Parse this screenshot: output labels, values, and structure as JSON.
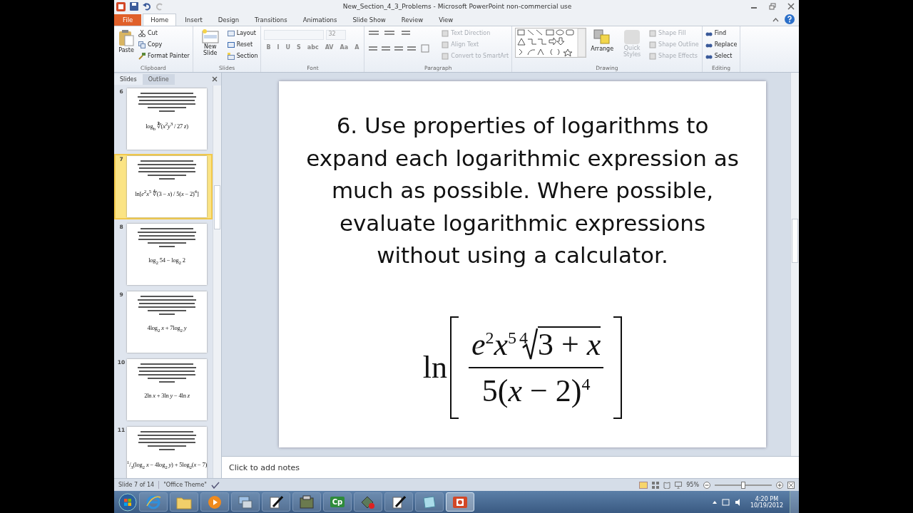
{
  "window": {
    "title": "New_Section_4_3_Problems - Microsoft PowerPoint non-commercial use"
  },
  "tabs": [
    {
      "label": "File",
      "kind": "file",
      "selected": false
    },
    {
      "label": "Home",
      "kind": "tab",
      "selected": true
    },
    {
      "label": "Insert",
      "kind": "tab",
      "selected": false
    },
    {
      "label": "Design",
      "kind": "tab",
      "selected": false
    },
    {
      "label": "Transitions",
      "kind": "tab",
      "selected": false
    },
    {
      "label": "Animations",
      "kind": "tab",
      "selected": false
    },
    {
      "label": "Slide Show",
      "kind": "tab",
      "selected": false
    },
    {
      "label": "Review",
      "kind": "tab",
      "selected": false
    },
    {
      "label": "View",
      "kind": "tab",
      "selected": false
    }
  ],
  "ribbon": {
    "clipboard": {
      "label": "Clipboard",
      "paste": "Paste",
      "cut": "Cut",
      "copy": "Copy",
      "format_painter": "Format Painter"
    },
    "slides": {
      "label": "Slides",
      "new_slide": "New Slide",
      "layout": "Layout",
      "reset": "Reset",
      "section": "Section"
    },
    "font": {
      "label": "Font",
      "font_size": "32",
      "format_buttons": [
        {
          "label": "B"
        },
        {
          "label": "I"
        },
        {
          "label": "U"
        },
        {
          "label": "S"
        },
        {
          "label": "abc"
        },
        {
          "label": "AV"
        },
        {
          "label": "Aa"
        },
        {
          "label": "A"
        }
      ]
    },
    "paragraph": {
      "label": "Paragraph",
      "commands": [
        {
          "label": "Text Direction",
          "disabled": true
        },
        {
          "label": "Align Text",
          "disabled": true
        },
        {
          "label": "Convert to SmartArt",
          "disabled": true
        }
      ]
    },
    "drawing": {
      "label": "Drawing",
      "arrange": "Arrange",
      "quick_styles": {
        "label": "Quick Styles",
        "disabled": true
      },
      "commands": [
        {
          "label": "Shape Fill",
          "disabled": true
        },
        {
          "label": "Shape Outline",
          "disabled": true
        },
        {
          "label": "Shape Effects",
          "disabled": true
        }
      ]
    },
    "editing": {
      "label": "Editing",
      "commands": [
        {
          "label": "Find"
        },
        {
          "label": "Replace"
        },
        {
          "label": "Select"
        }
      ]
    }
  },
  "pane": {
    "tabs": [
      {
        "label": "Slides",
        "selected": true
      },
      {
        "label": "Outline",
        "selected": false
      }
    ],
    "thumbnails": [
      {
        "number": "6",
        "selected": false,
        "formula": "log$_{b}$ ∛(*x*$^{2}$*y*$^{3}$ / 27 *z*)"
      },
      {
        "number": "7",
        "selected": true,
        "formula": "ln[*e*$^{2}$*x*$^{5}$ ∜(3 − *x*) / 5(*x* − 2)$^{4}$]"
      },
      {
        "number": "8",
        "selected": false,
        "formula": "log$_{2}$ 54 − log$_{2}$ 2"
      },
      {
        "number": "9",
        "selected": false,
        "formula": "4log$_{2}$ *x* + 7log$_{2}$ *y*"
      },
      {
        "number": "10",
        "selected": false,
        "formula": "2ln *x* + 3ln *y* − 4ln *z*"
      },
      {
        "number": "11",
        "selected": false,
        "formula": "$^{1}$/$_{3}$(log$_{2}$ *x* − 4log$_{2}$ *y*) + 5log$_{2}$(*x* − 7)"
      }
    ]
  },
  "slide": {
    "title": "6. Use properties of logarithms to expand each logarithmic expression as much as possible.  Where possible, evaluate logarithmic expressions without using a calculator.",
    "formula": {
      "function": "ln",
      "numerator": "*e*$^{2}$*x*$^{5}$",
      "root_index": "4",
      "radicand": "3 + *x*",
      "denominator": "5(*x* − 2)$^{4}$"
    }
  },
  "notes": {
    "placeholder": "Click to add notes"
  },
  "status_bar": {
    "slide_info": "Slide 7 of 14",
    "theme": "\"Office Theme\"",
    "zoom": "95%",
    "zoom_slider": {
      "level": 0.5
    }
  },
  "taskbar": {
    "apps": [
      {
        "kind": "browser",
        "selected": false
      },
      {
        "kind": "folder",
        "selected": false
      },
      {
        "kind": "media",
        "selected": false
      },
      {
        "kind": "tool",
        "selected": false
      },
      {
        "kind": "pen",
        "selected": false
      },
      {
        "kind": "archive",
        "selected": false
      },
      {
        "kind": "text",
        "label": "Cp",
        "selected": false
      },
      {
        "kind": "recorder",
        "selected": false
      },
      {
        "kind": "pen",
        "selected": false
      },
      {
        "kind": "notes",
        "selected": false
      },
      {
        "kind": "presentation",
        "selected": true
      }
    ],
    "time": "4:20 PM",
    "date": "10/19/2012"
  }
}
